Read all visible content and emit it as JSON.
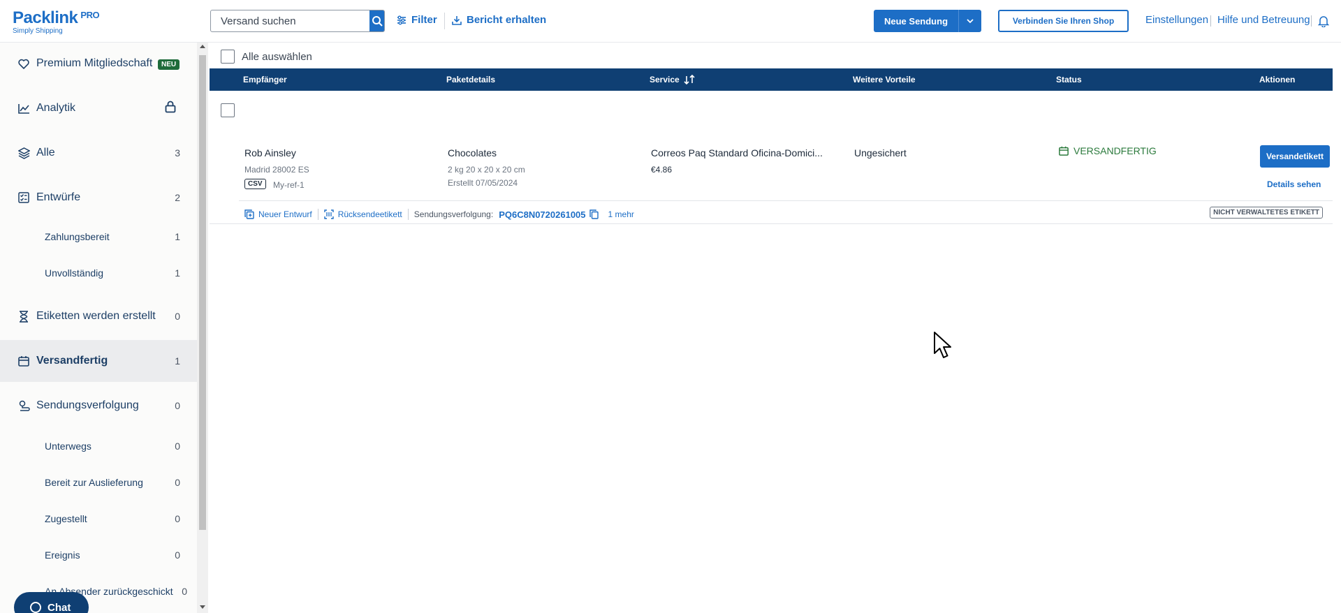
{
  "header": {
    "logo": "Packlink",
    "logo_pro": "PRO",
    "logo_tagline": "Simply Shipping",
    "search_placeholder": "Versand suchen",
    "filter_label": "Filter",
    "report_label": "Bericht erhalten",
    "new_shipment_label": "Neue Sendung",
    "connect_shop_label": "Verbinden Sie Ihren Shop",
    "settings_label": "Einstellungen",
    "help_label": "Hilfe und Betreuung"
  },
  "sidebar": {
    "premium": {
      "label": "Premium Mitgliedschaft",
      "badge": "NEU"
    },
    "analytics": {
      "label": "Analytik"
    },
    "all": {
      "label": "Alle",
      "count": "3"
    },
    "drafts": {
      "label": "Entwürfe",
      "count": "2"
    },
    "ready_to_pay": {
      "label": "Zahlungsbereit",
      "count": "1"
    },
    "incomplete": {
      "label": "Unvollständig",
      "count": "1"
    },
    "labels_creating": {
      "label": "Etiketten werden erstellt",
      "count": "0"
    },
    "ready_to_ship": {
      "label": "Versandfertig",
      "count": "1"
    },
    "tracking": {
      "label": "Sendungsverfolgung",
      "count": "0"
    },
    "in_transit": {
      "label": "Unterwegs",
      "count": "0"
    },
    "ready_for_delivery": {
      "label": "Bereit zur Auslieferung",
      "count": "0"
    },
    "delivered": {
      "label": "Zugestellt",
      "count": "0"
    },
    "incident": {
      "label": "Ereignis",
      "count": "0"
    },
    "returned": {
      "label": "An Absender zurückgeschickt",
      "count": "0"
    }
  },
  "chat_label": "Chat",
  "main": {
    "select_all_label": "Alle auswählen",
    "columns": {
      "recipient": "Empfänger",
      "package": "Paketdetails",
      "service": "Service",
      "benefits": "Weitere Vorteile",
      "status": "Status",
      "actions": "Aktionen"
    },
    "row": {
      "recipient_name": "Rob Ainsley",
      "recipient_address": "Madrid 28002 ES",
      "source_tag": "CSV",
      "reference": "My-ref-1",
      "package_name": "Chocolates",
      "package_dims": "2 kg 20 x 20 x 20 cm",
      "package_created": "Erstellt 07/05/2024",
      "service_name": "Correos Paq Standard Oficina-Domici...",
      "service_price": "€4.86",
      "benefits": "Ungesichert",
      "status": "VERSANDFERTIG",
      "action_primary": "Versandetikett",
      "action_details": "Details sehen",
      "foot_new_draft": "Neuer Entwurf",
      "foot_return_label": "Rücksendeetikett",
      "foot_tracking_label": "Sendungsverfolgung:",
      "foot_tracking_number": "PQ6C8N0720261005",
      "foot_more": "1 mehr",
      "unmanaged_tag": "NICHT VERWALTETES ETIKETT"
    }
  },
  "colors": {
    "primary": "#1d6ec6",
    "navy": "#0f3f73",
    "status_green": "#2b7a3c"
  }
}
